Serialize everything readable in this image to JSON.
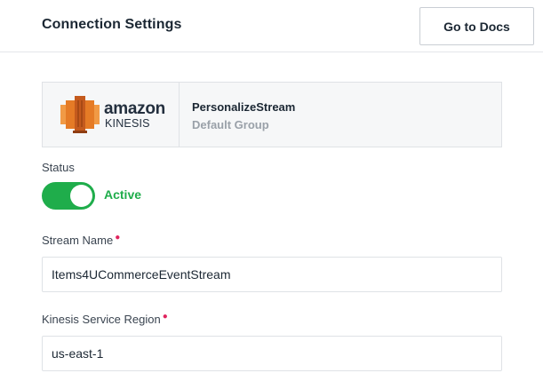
{
  "header": {
    "title": "Connection Settings",
    "docs_button_label": "Go to Docs"
  },
  "source": {
    "logo": {
      "word": "amazon",
      "sub": "KINESIS",
      "icon": "kinesis-logo-icon",
      "colors": {
        "orange": "#e57b26",
        "dark": "#232f3e"
      }
    },
    "name": "PersonalizeStream",
    "group": "Default Group"
  },
  "status": {
    "label": "Status",
    "enabled": true,
    "value_text": "Active",
    "color": "#1fad4b"
  },
  "fields": {
    "stream_name": {
      "label": "Stream Name",
      "required": true,
      "value": "Items4UCommerceEventStream"
    },
    "region": {
      "label": "Kinesis Service Region",
      "required": true,
      "value": "us-east-1"
    }
  },
  "colors": {
    "required": "#e0245e",
    "card_bg": "#f6f7f8",
    "border": "#dfe2e6"
  }
}
